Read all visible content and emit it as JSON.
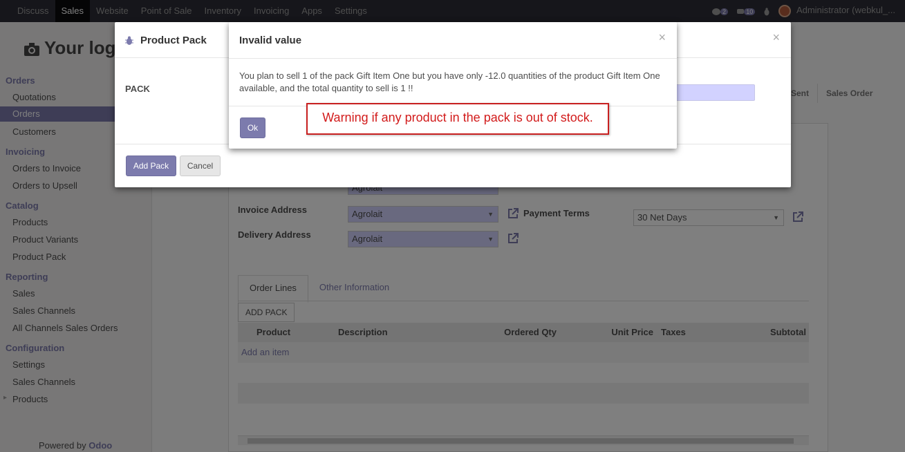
{
  "topbar": {
    "menu": [
      "Discuss",
      "Sales",
      "Website",
      "Point of Sale",
      "Inventory",
      "Invoicing",
      "Apps",
      "Settings"
    ],
    "active": "Sales",
    "chat_badge": "2",
    "msg_badge": "10",
    "user": "Administrator (webkul_..."
  },
  "sidebar": {
    "logo": "Your log",
    "sections": [
      {
        "title": "Orders",
        "items": [
          "Quotations",
          "Orders",
          "Customers"
        ]
      },
      {
        "title": "Invoicing",
        "items": [
          "Orders to Invoice",
          "Orders to Upsell"
        ]
      },
      {
        "title": "Catalog",
        "items": [
          "Products",
          "Product Variants",
          "Product Pack"
        ]
      },
      {
        "title": "Reporting",
        "items": [
          "Sales",
          "Sales Channels",
          "All Channels Sales Orders"
        ]
      },
      {
        "title": "Configuration",
        "items": [
          "Settings",
          "Sales Channels",
          "Products"
        ]
      }
    ],
    "powered_prefix": "Powered by",
    "powered_brand": "Odoo"
  },
  "form": {
    "status": [
      "on Sent",
      "Sales Order"
    ],
    "customer_value": "Agrolait",
    "invoice_address_label": "Invoice Address",
    "invoice_address_value": "Agrolait",
    "delivery_address_label": "Delivery Address",
    "delivery_address_value": "Agrolait",
    "payment_terms_label": "Payment Terms",
    "payment_terms_value": "30 Net Days",
    "tabs": [
      "Order Lines",
      "Other Information"
    ],
    "add_pack_button": "ADD PACK",
    "columns": [
      "Product",
      "Description",
      "Ordered Qty",
      "Unit Price",
      "Taxes",
      "Subtotal"
    ],
    "add_item": "Add an item"
  },
  "pack_dialog": {
    "title": "Product Pack",
    "field_label": "PACK",
    "add_button": "Add Pack",
    "cancel_button": "Cancel",
    "close": "×"
  },
  "error_dialog": {
    "title": "Invalid value",
    "message": "You plan to sell 1 of the pack Gift Item One but you have only -12.0 quantities of the product Gift Item One available, and the total quantity to sell is 1 !!",
    "ok_button": "Ok",
    "close": "×"
  },
  "annotation": "Warning if any product in the pack is out of stock.",
  "colors": {
    "accent": "#7c7bad",
    "warning": "#d21b1b"
  }
}
